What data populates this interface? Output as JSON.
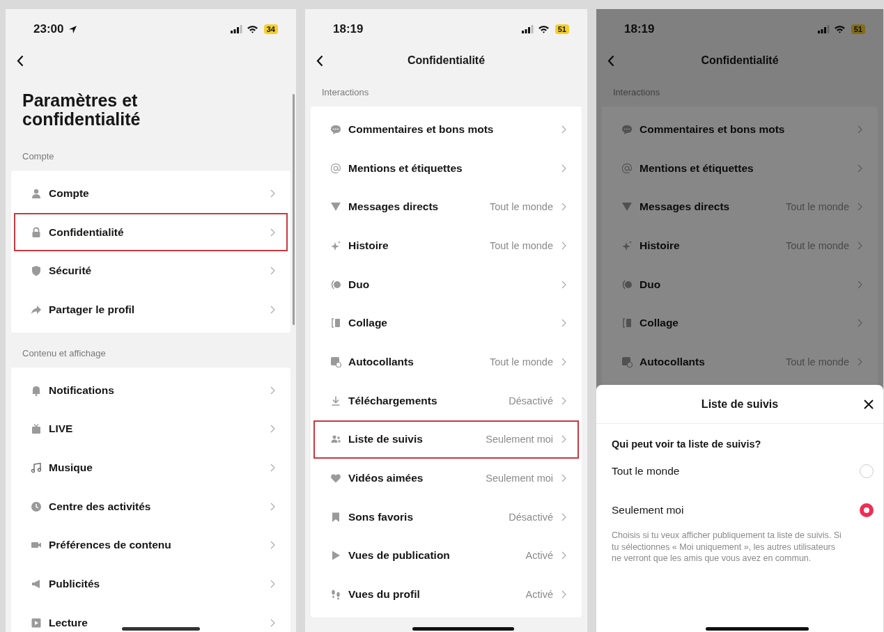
{
  "screens": [
    {
      "status": {
        "time": "23:00",
        "location_arrow": true,
        "battery": "34"
      },
      "title": "Paramètres et confidentialité",
      "kind": "large",
      "dimmed": false,
      "scrollbar": true,
      "sections": [
        {
          "label": "Compte",
          "items": [
            {
              "label": "Compte",
              "highlighted": false
            },
            {
              "label": "Confidentialité",
              "highlighted": true
            },
            {
              "label": "Sécurité",
              "highlighted": false
            },
            {
              "label": "Partager le profil",
              "highlighted": false
            }
          ]
        },
        {
          "label": "Contenu et affichage",
          "items": [
            {
              "label": "Notifications",
              "highlighted": false
            },
            {
              "label": "LIVE",
              "highlighted": false
            },
            {
              "label": "Musique",
              "highlighted": false
            },
            {
              "label": "Centre des activités",
              "highlighted": false
            },
            {
              "label": "Préférences de contenu",
              "highlighted": false
            },
            {
              "label": "Publicités",
              "highlighted": false
            },
            {
              "label": "Lecture",
              "highlighted": false
            }
          ]
        }
      ]
    },
    {
      "status": {
        "time": "18:19",
        "location_arrow": false,
        "battery": "51"
      },
      "title": "Confidentialité",
      "kind": "centered",
      "dimmed": false,
      "scrollbar": false,
      "sections": [
        {
          "label": "Interactions",
          "items": [
            {
              "label": "Commentaires et bons mots",
              "highlighted": false
            },
            {
              "label": "Mentions et étiquettes",
              "highlighted": false
            },
            {
              "label": "Messages directs",
              "value": "Tout le monde",
              "highlighted": false
            },
            {
              "label": "Histoire",
              "value": "Tout le monde",
              "highlighted": false
            },
            {
              "label": "Duo",
              "highlighted": false
            },
            {
              "label": "Collage",
              "highlighted": false
            },
            {
              "label": "Autocollants",
              "value": "Tout le monde",
              "highlighted": false
            },
            {
              "label": "Téléchargements",
              "value": "Désactivé",
              "highlighted": false
            },
            {
              "label": "Liste de suivis",
              "value": "Seulement moi",
              "highlighted": true
            },
            {
              "label": "Vidéos aimées",
              "value": "Seulement moi",
              "highlighted": false
            },
            {
              "label": "Sons favoris",
              "value": "Désactivé",
              "highlighted": false
            },
            {
              "label": "Vues de publication",
              "value": "Activé",
              "highlighted": false
            },
            {
              "label": "Vues du profil",
              "value": "Activé",
              "highlighted": false
            }
          ]
        }
      ]
    },
    {
      "status": {
        "time": "18:19",
        "location_arrow": false,
        "battery": "51"
      },
      "title": "Confidentialité",
      "kind": "centered",
      "dimmed": true,
      "scrollbar": false,
      "sections": [
        {
          "label": "Interactions",
          "items": [
            {
              "label": "Commentaires et bons mots",
              "highlighted": false
            },
            {
              "label": "Mentions et étiquettes",
              "highlighted": false
            },
            {
              "label": "Messages directs",
              "value": "Tout le monde",
              "highlighted": false
            },
            {
              "label": "Histoire",
              "value": "Tout le monde",
              "highlighted": false
            },
            {
              "label": "Duo",
              "highlighted": false
            },
            {
              "label": "Collage",
              "highlighted": false
            },
            {
              "label": "Autocollants",
              "value": "Tout le monde",
              "highlighted": false
            }
          ]
        }
      ],
      "sheet": {
        "title": "Liste de suivis",
        "question": "Qui peut voir ta liste de suivis?",
        "options": [
          {
            "label": "Tout le monde",
            "selected": false
          },
          {
            "label": "Seulement moi",
            "selected": true
          }
        ],
        "description": "Choisis si tu veux afficher publiquement ta liste de suivis. Si tu sélectionnes « Moi uniquement », les autres utilisateurs ne verront que les amis que vous avez en commun."
      }
    }
  ]
}
